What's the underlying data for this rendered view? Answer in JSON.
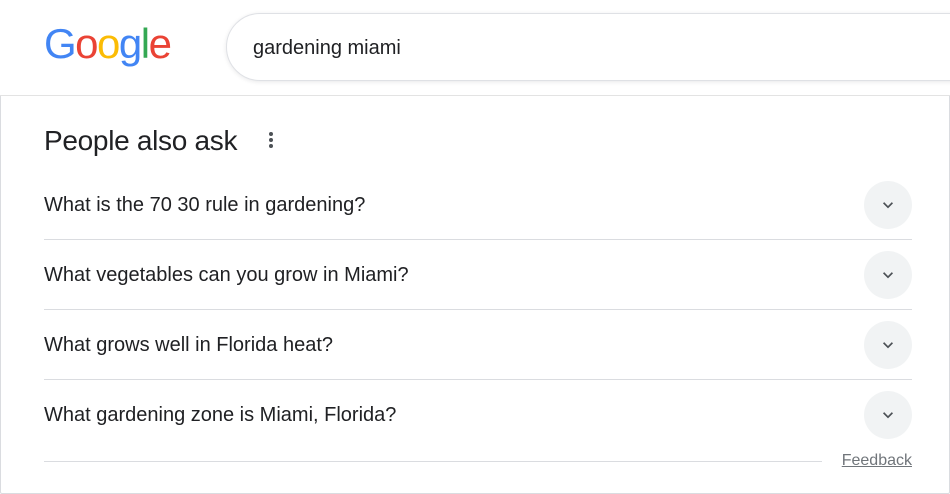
{
  "logo": {
    "letters": [
      "G",
      "o",
      "o",
      "g",
      "l",
      "e"
    ],
    "colors": [
      "#4285F4",
      "#EA4335",
      "#FBBC05",
      "#4285F4",
      "#34A853",
      "#EA4335"
    ]
  },
  "search": {
    "value": "gardening miami"
  },
  "paa": {
    "title": "People also ask",
    "menu_icon": "more-vert-icon",
    "questions": [
      {
        "text": "What is the 70 30 rule in gardening?",
        "icon": "chevron-down-icon"
      },
      {
        "text": "What vegetables can you grow in Miami?",
        "icon": "chevron-down-icon"
      },
      {
        "text": "What grows well in Florida heat?",
        "icon": "chevron-down-icon"
      },
      {
        "text": "What gardening zone is Miami, Florida?",
        "icon": "chevron-down-icon"
      }
    ]
  },
  "footer": {
    "feedback_label": "Feedback"
  }
}
